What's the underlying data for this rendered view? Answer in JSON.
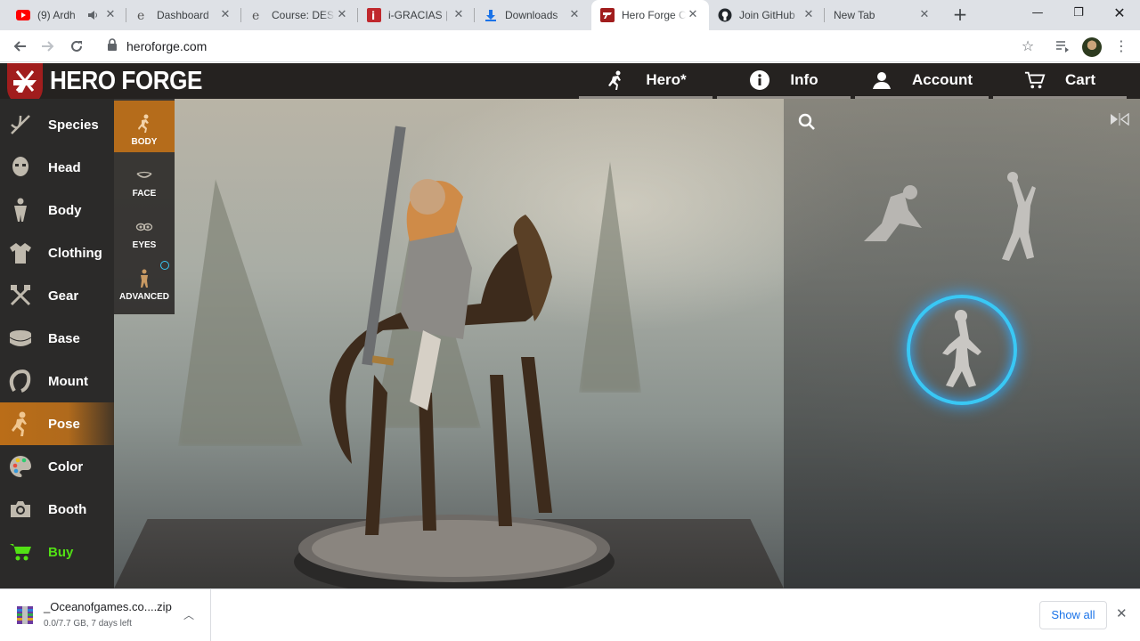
{
  "browser": {
    "tabs": [
      {
        "title": "(9) Ardh",
        "favicon": "youtube-icon",
        "audio": true
      },
      {
        "title": "Dashboard",
        "favicon": "edge-e-icon"
      },
      {
        "title": "Course: DESI",
        "favicon": "edge-e-icon"
      },
      {
        "title": "i-GRACIAS |",
        "favicon": "red-i-icon"
      },
      {
        "title": "Downloads",
        "favicon": "download-icon"
      },
      {
        "title": "Hero Forge C",
        "favicon": "heroforge-icon",
        "active": true
      },
      {
        "title": "Join GitHub",
        "favicon": "github-icon"
      },
      {
        "title": "New Tab",
        "favicon": ""
      }
    ],
    "url": "heroforge.com"
  },
  "app": {
    "brand": "HERO FORGE",
    "nav": [
      {
        "label": "Hero*",
        "icon": "hero-icon"
      },
      {
        "label": "Info",
        "icon": "info-icon"
      },
      {
        "label": "Account",
        "icon": "user-icon"
      },
      {
        "label": "Cart",
        "icon": "cart-icon"
      }
    ],
    "menu": [
      {
        "label": "Species",
        "icon": "dna-icon"
      },
      {
        "label": "Head",
        "icon": "head-icon"
      },
      {
        "label": "Body",
        "icon": "body-icon"
      },
      {
        "label": "Clothing",
        "icon": "shirt-icon"
      },
      {
        "label": "Gear",
        "icon": "crossed-weapons-icon"
      },
      {
        "label": "Base",
        "icon": "base-icon"
      },
      {
        "label": "Mount",
        "icon": "horseshoe-icon"
      },
      {
        "label": "Pose",
        "icon": "pose-icon",
        "active": true
      },
      {
        "label": "Color",
        "icon": "palette-icon"
      },
      {
        "label": "Booth",
        "icon": "camera-icon"
      },
      {
        "label": "Buy",
        "icon": "cart-icon",
        "highlight": "#52e014"
      }
    ],
    "submenu": [
      {
        "label": "BODY",
        "icon": "running-figure-icon",
        "active": true
      },
      {
        "label": "FACE",
        "icon": "mouth-icon"
      },
      {
        "label": "EYES",
        "icon": "eyes-icon"
      },
      {
        "label": "ADVANCED",
        "icon": "figure-advanced-icon"
      }
    ],
    "accent": "#b56c1b"
  },
  "download": {
    "filename": "_Oceanofgames.co....zip",
    "status": "0.0/7.7 GB, 7 days left",
    "show_all": "Show all"
  }
}
